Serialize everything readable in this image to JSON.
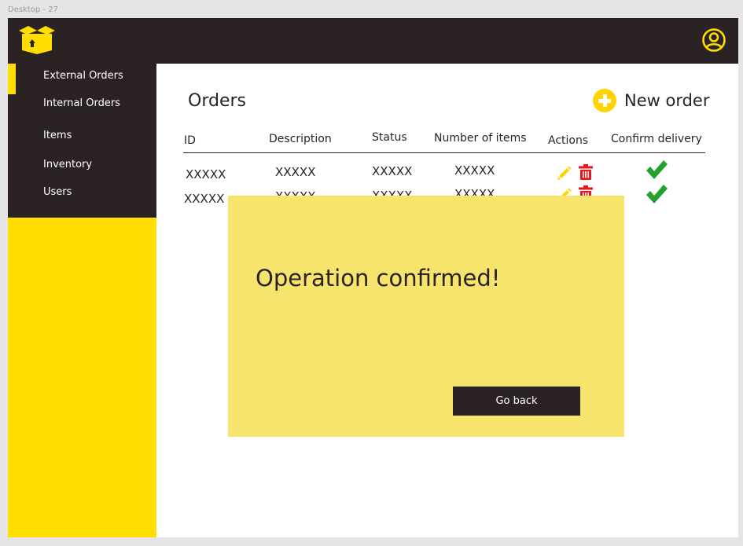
{
  "frame_label": "Desktop - 27",
  "colors": {
    "dark": "#2b2224",
    "yellow": "#ffde00",
    "modal": "#f7e46d",
    "edit": "#ffd400",
    "delete": "#e8161d",
    "confirm": "#24a12c"
  },
  "sidebar": {
    "items": [
      {
        "label": "External Orders",
        "active": true
      },
      {
        "label": "Internal Orders"
      },
      {
        "label": "Items"
      },
      {
        "label": "Inventory"
      },
      {
        "label": "Users"
      }
    ]
  },
  "icons": {
    "logo": "box-logo-icon",
    "user": "user-account-icon",
    "add": "plus-circle-icon",
    "edit": "pencil-icon",
    "delete": "trash-icon",
    "confirm": "checkmark-icon"
  },
  "main": {
    "title": "Orders",
    "new_order_label": "New order",
    "table": {
      "headers": [
        "ID",
        "Description",
        "Status",
        "Number of items",
        "Actions",
        "Confirm delivery"
      ],
      "rows": [
        [
          "XXXXX",
          "XXXXX",
          "XXXXX",
          "XXXXX"
        ],
        [
          "XXXXX",
          "XXXXX",
          "XXXXX",
          "XXXXX"
        ]
      ]
    }
  },
  "modal": {
    "message": "Operation confirmed!",
    "button_label": "Go back"
  }
}
